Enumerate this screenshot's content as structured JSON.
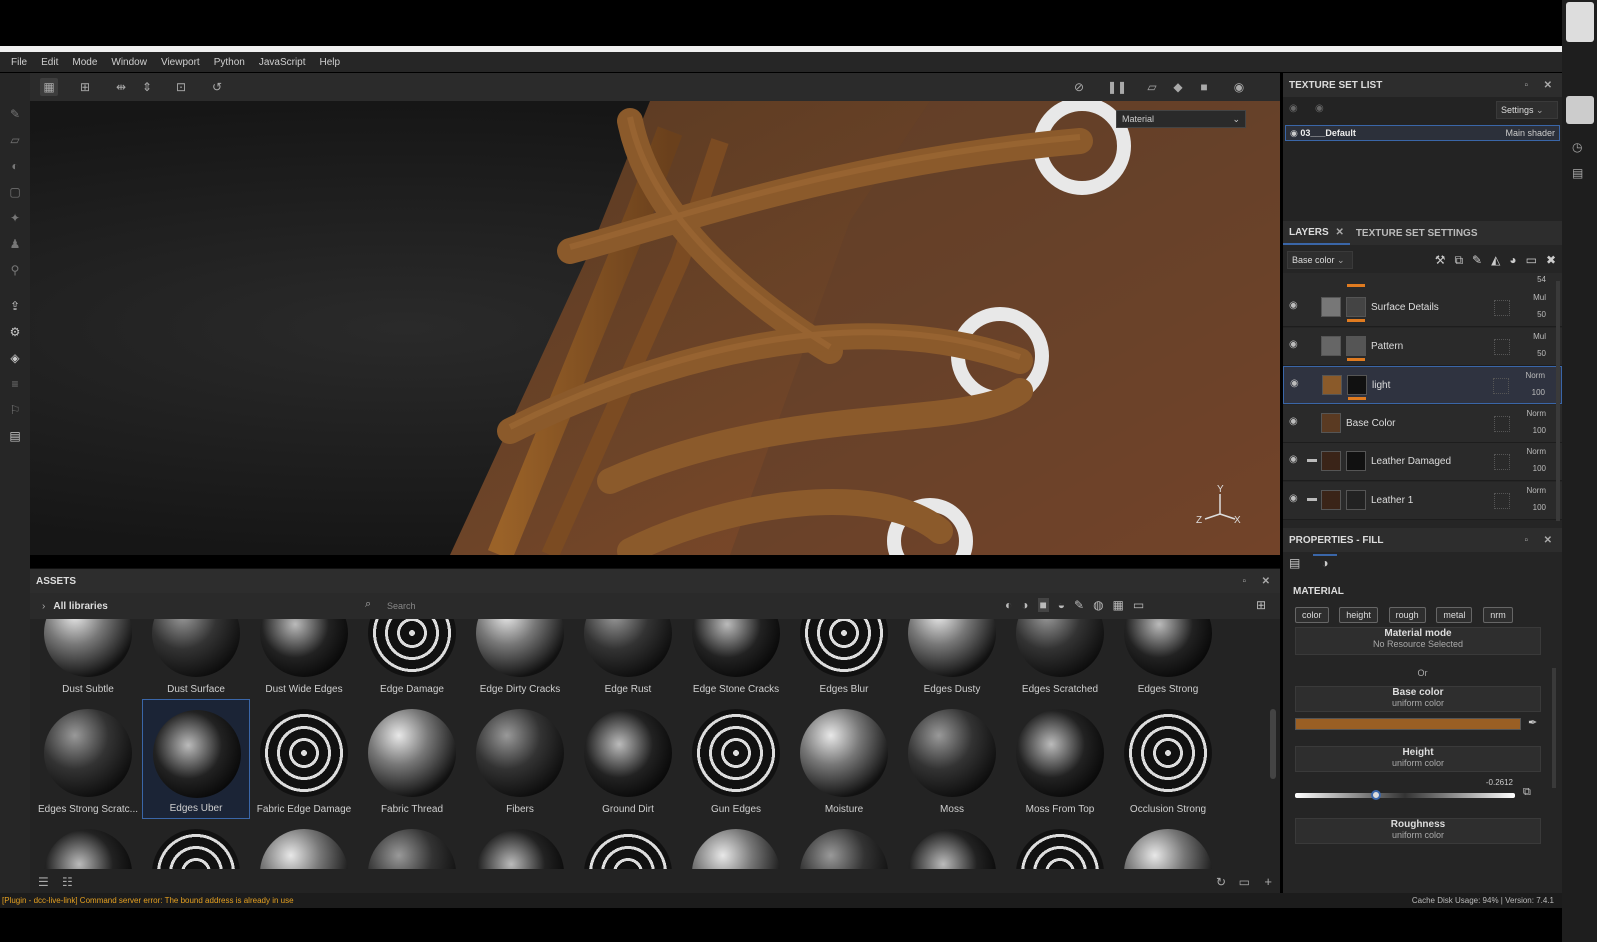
{
  "menu": [
    "File",
    "Edit",
    "Mode",
    "Window",
    "Viewport",
    "Python",
    "JavaScript",
    "Help"
  ],
  "viewport": {
    "material_dropdown": "Material",
    "axes": {
      "y": "Y",
      "z": "Z",
      "x": "X"
    }
  },
  "texture_set_list": {
    "title": "TEXTURE SET LIST",
    "settings_label": "Settings",
    "item_name": "03___Default",
    "item_shader": "Main shader"
  },
  "layers_panel": {
    "tab_layers": "LAYERS",
    "tab_settings": "TEXTURE SET SETTINGS",
    "channel_dropdown": "Base color",
    "top_partial_value": "54",
    "layers": [
      {
        "name": "Surface Details",
        "blend": "Mul",
        "opacity": "50"
      },
      {
        "name": "Pattern",
        "blend": "Mul",
        "opacity": "50"
      },
      {
        "name": "light",
        "blend": "Norm",
        "opacity": "100"
      },
      {
        "name": "Base Color",
        "blend": "Norm",
        "opacity": "100"
      },
      {
        "name": "Leather Damaged",
        "blend": "Norm",
        "opacity": "100"
      },
      {
        "name": "Leather 1",
        "blend": "Norm",
        "opacity": "100"
      }
    ]
  },
  "properties": {
    "title": "PROPERTIES - FILL",
    "section": "MATERIAL",
    "chips": [
      "color",
      "height",
      "rough",
      "metal",
      "nrm"
    ],
    "material_mode_title": "Material mode",
    "material_mode_value": "No Resource Selected",
    "or_label": "Or",
    "base_color_title": "Base color",
    "base_color_sub": "uniform color",
    "base_color_hex": "#9a5f24",
    "height_title": "Height",
    "height_sub": "uniform color",
    "height_value": "-0.2612",
    "height_fraction": 0.37,
    "roughness_title": "Roughness",
    "roughness_sub": "uniform color"
  },
  "assets": {
    "title": "ASSETS",
    "breadcrumb": "All libraries",
    "search_placeholder": "Search",
    "row1": [
      "Dust Subtle",
      "Dust Surface",
      "Dust Wide Edges",
      "Edge Damage",
      "Edge Dirty Cracks",
      "Edge Rust",
      "Edge Stone Cracks",
      "Edges Blur",
      "Edges Dusty",
      "Edges Scratched",
      "Edges Strong"
    ],
    "row2": [
      "Edges Strong Scratc...",
      "Edges Uber",
      "Fabric Edge Damage",
      "Fabric Thread",
      "Fibers",
      "Ground Dirt",
      "Gun Edges",
      "Moisture",
      "Moss",
      "Moss From Top",
      "Occlusion Strong"
    ]
  },
  "status": {
    "message": "[Plugin - dcc-live-link] Command server error: The bound address is already in use",
    "cache": "Cache Disk Usage:   94% | Version: 7.4.1"
  }
}
